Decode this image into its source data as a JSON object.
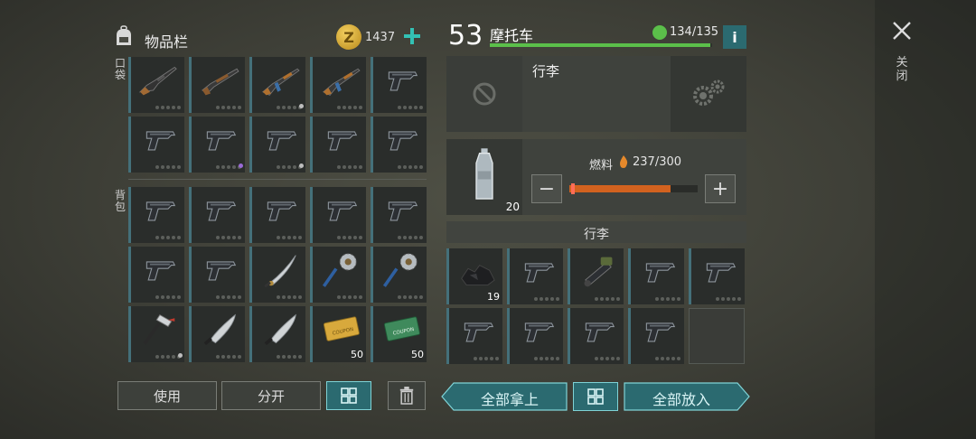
{
  "inventory": {
    "title": "物品栏",
    "coins": "1437",
    "pocket_label": "口袋",
    "backpack_label": "背包",
    "pocket": [
      {
        "icon": "rifle-icon",
        "color": "#a16a34"
      },
      {
        "icon": "shotgun-icon",
        "color": "#8a5a2e"
      },
      {
        "icon": "ak-rifle-icon",
        "color": "#3b6fa8",
        "mark": "#bdbdbd"
      },
      {
        "icon": "ak-rifle-icon",
        "color": "#3b6fa8"
      },
      {
        "icon": "pistol-icon"
      },
      {
        "icon": "pistol-icon"
      },
      {
        "icon": "pistol-icon",
        "mark": "#9a6ad6"
      },
      {
        "icon": "pistol-icon",
        "mark": "#bdbdbd"
      },
      {
        "icon": "pistol-icon"
      },
      {
        "icon": "pistol-icon"
      }
    ],
    "backpack": [
      {
        "icon": "pistol-icon"
      },
      {
        "icon": "pistol-icon"
      },
      {
        "icon": "pistol-icon"
      },
      {
        "icon": "pistol-icon"
      },
      {
        "icon": "pistol-icon"
      },
      {
        "icon": "pistol-icon"
      },
      {
        "icon": "pistol-icon"
      },
      {
        "icon": "katana-icon"
      },
      {
        "icon": "saw-mace-icon"
      },
      {
        "icon": "saw-mace-icon"
      },
      {
        "icon": "hammer-icon",
        "mark": "#bdbdbd"
      },
      {
        "icon": "machete-icon"
      },
      {
        "icon": "machete-icon"
      },
      {
        "icon": "coupon-gold-icon",
        "qty": "50"
      },
      {
        "icon": "coupon-green-icon",
        "qty": "50"
      }
    ],
    "use_label": "使用",
    "split_label": "分开"
  },
  "vehicle": {
    "level": "53",
    "name": "摩托车",
    "durability": "134/135",
    "durability_fraction": 0.99,
    "luggage_title": "行李",
    "fuel_label": "燃料",
    "fuel_value": "237/300",
    "fuel_fraction": 0.79,
    "fuel_item_qty": "20",
    "storage_title": "行李",
    "storage": [
      {
        "icon": "coal-icon",
        "qty": "19"
      },
      {
        "icon": "pistol-icon"
      },
      {
        "icon": "flamethrower-icon"
      },
      {
        "icon": "pistol-icon"
      },
      {
        "icon": "pistol-icon"
      },
      {
        "icon": "pistol-icon"
      },
      {
        "icon": "pistol-icon"
      },
      {
        "icon": "pistol-icon"
      },
      {
        "icon": "pistol-icon"
      },
      {
        "icon": "empty"
      }
    ],
    "take_all_label": "全部拿上",
    "put_all_label": "全部放入"
  },
  "close_label": "关闭",
  "colors": {
    "teal": "#2b6a70",
    "green_bar": "#5bbf4a",
    "fuel_bar": "#d2621f",
    "accent_plus": "#33c1b4"
  }
}
